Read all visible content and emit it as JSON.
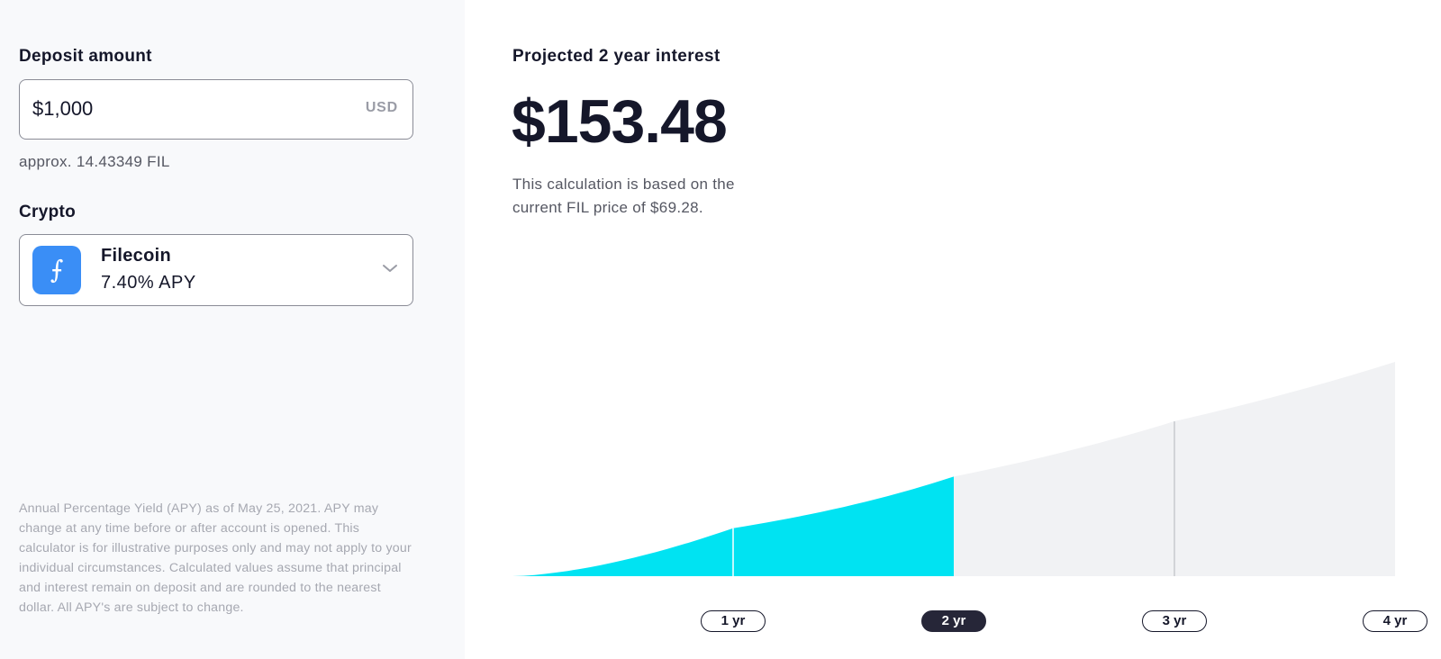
{
  "deposit": {
    "label": "Deposit amount",
    "value": "$1,000",
    "currency": "USD",
    "approx": "approx. 14.43349 FIL"
  },
  "crypto": {
    "label": "Crypto",
    "selected_name": "Filecoin",
    "selected_apy": "7.40% APY",
    "icon_glyph": "⨍",
    "icon": "filecoin-icon",
    "icon_color": "#3a8ef6"
  },
  "disclaimer": "Annual Percentage Yield (APY) as of May 25, 2021. APY may change at any time before or after account is opened. This calculator is for illustrative purposes only and may not apply to your individual circumstances. Calculated values assume that principal and interest remain on deposit and are rounded to the nearest dollar. All APY's are subject to change.",
  "projection": {
    "title": "Projected 2 year interest",
    "amount": "$153.48",
    "note": "This calculation is based on the current FIL price of $69.28."
  },
  "colors": {
    "accent": "#00e3f2",
    "future_area": "#f1f2f4",
    "active_pill": "#262638"
  },
  "chart_data": {
    "type": "area",
    "x": [
      0,
      1,
      2,
      3,
      4
    ],
    "x_tick_labels": [
      "1 yr",
      "2 yr",
      "3 yr",
      "4 yr"
    ],
    "y": [
      0,
      74,
      153.48,
      238.68,
      330.15
    ],
    "selected_year": 2,
    "grid": false,
    "title": "",
    "xlabel": "",
    "ylabel": ""
  }
}
